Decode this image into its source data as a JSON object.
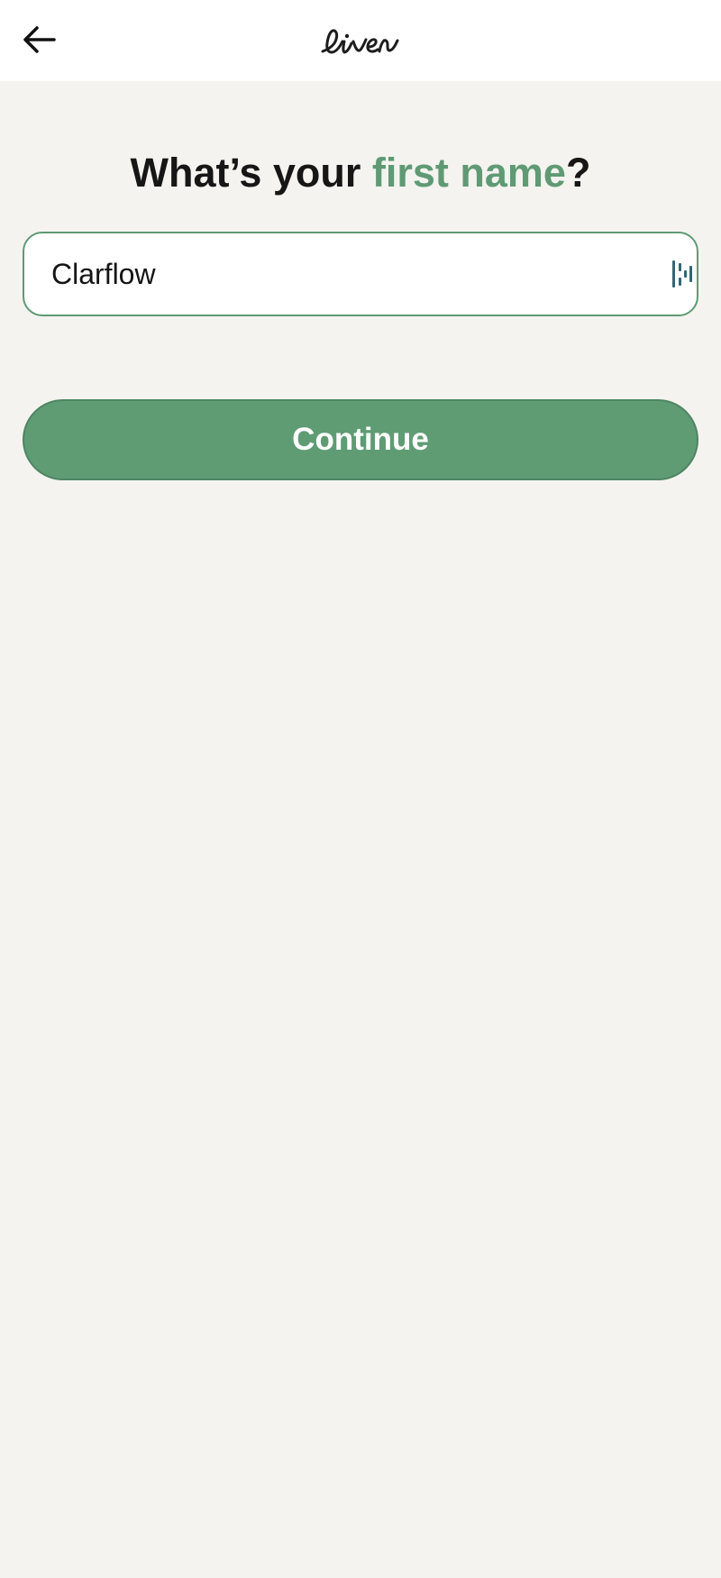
{
  "header": {
    "logo_text": "liven",
    "back_icon": "back-arrow-icon"
  },
  "question": {
    "prefix": "What’s your ",
    "highlight": "first name",
    "suffix": "?"
  },
  "name_field": {
    "value": "Clarflow",
    "autofill_icon": "password-manager-icon"
  },
  "actions": {
    "continue_label": "Continue"
  },
  "colors": {
    "background": "#f4f3ef",
    "accent": "#5f9a74",
    "button_fill": "#5f9c74",
    "text": "#151515"
  }
}
